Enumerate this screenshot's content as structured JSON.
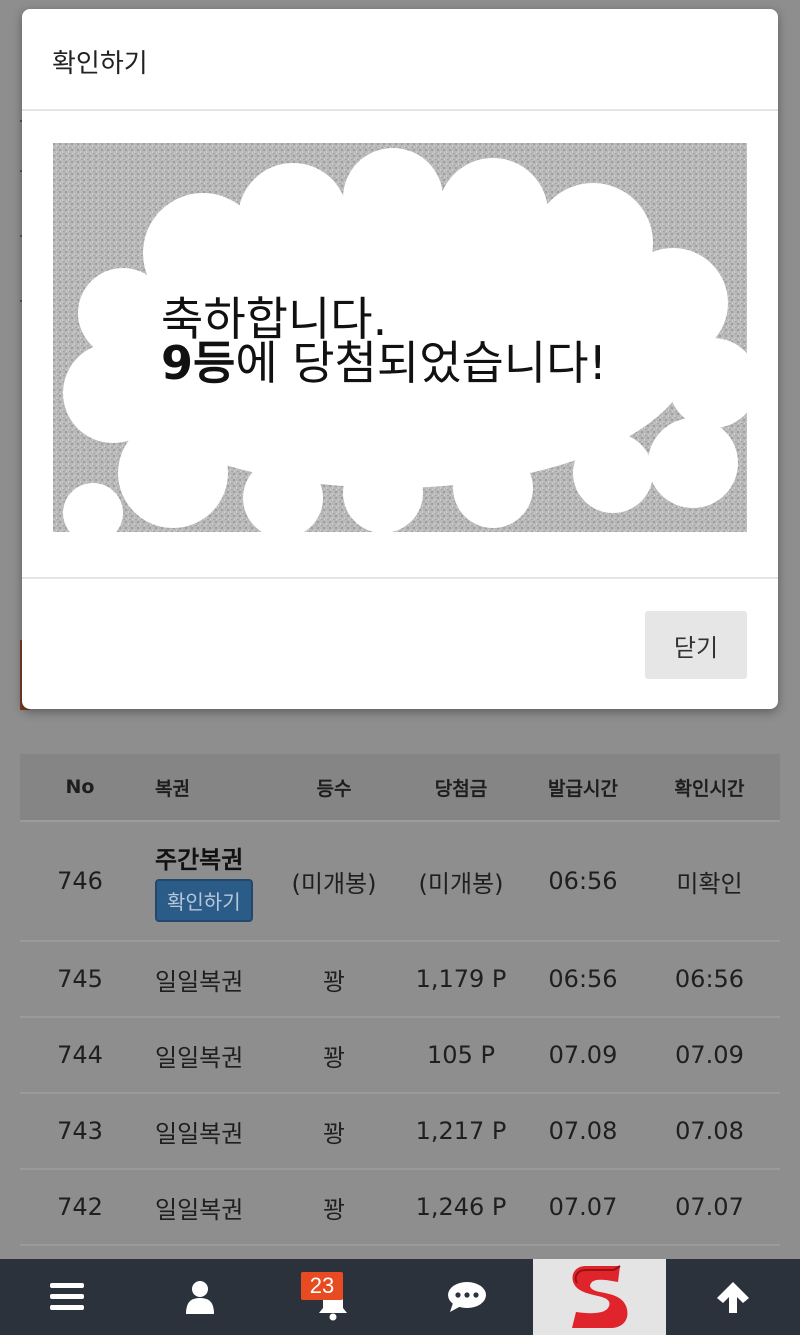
{
  "modal": {
    "title": "확인하기",
    "image": {
      "line1": "축하합니다.",
      "rank": "9등",
      "line2_rest": "에 당첨되었습니다!"
    },
    "close_label": "닫기"
  },
  "table": {
    "headers": [
      "No",
      "복권",
      "등수",
      "당첨금",
      "발급시간",
      "확인시간"
    ],
    "rows": [
      {
        "no": "746",
        "type": "주간복권",
        "button": "확인하기",
        "rank": "(미개봉)",
        "prize": "(미개봉)",
        "issued": "06:56",
        "checked": "미확인"
      },
      {
        "no": "745",
        "type": "일일복권",
        "rank": "꽝",
        "prize": "1,179 P",
        "issued": "06:56",
        "checked": "06:56"
      },
      {
        "no": "744",
        "type": "일일복권",
        "rank": "꽝",
        "prize": "105 P",
        "issued": "07.09",
        "checked": "07.09"
      },
      {
        "no": "743",
        "type": "일일복권",
        "rank": "꽝",
        "prize": "1,217 P",
        "issued": "07.08",
        "checked": "07.08"
      },
      {
        "no": "742",
        "type": "일일복권",
        "rank": "꽝",
        "prize": "1,246 P",
        "issued": "07.07",
        "checked": "07.07"
      }
    ]
  },
  "bottom_bar": {
    "items": [
      {
        "icon": "menu-icon"
      },
      {
        "icon": "user-icon"
      },
      {
        "icon": "bell-icon",
        "badge": "23"
      },
      {
        "icon": "chat-icon"
      },
      {
        "icon": "logo-s"
      },
      {
        "icon": "arrow-up-icon"
      }
    ]
  },
  "colors": {
    "overlay": "#8e8e8e",
    "bar": "#2b323b",
    "badge": "#e84b22",
    "logo_red": "#e0242b",
    "button_blue": "#2b5c88"
  }
}
